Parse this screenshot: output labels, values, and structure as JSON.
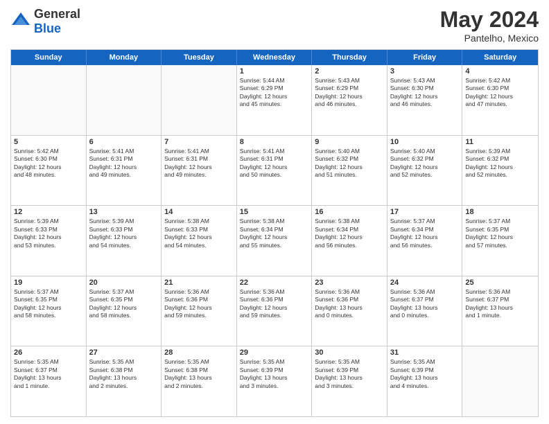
{
  "logo": {
    "general": "General",
    "blue": "Blue"
  },
  "title": "May 2024",
  "location": "Pantelho, Mexico",
  "days_of_week": [
    "Sunday",
    "Monday",
    "Tuesday",
    "Wednesday",
    "Thursday",
    "Friday",
    "Saturday"
  ],
  "weeks": [
    [
      {
        "day": "",
        "info": ""
      },
      {
        "day": "",
        "info": ""
      },
      {
        "day": "",
        "info": ""
      },
      {
        "day": "1",
        "info": "Sunrise: 5:44 AM\nSunset: 6:29 PM\nDaylight: 12 hours\nand 45 minutes."
      },
      {
        "day": "2",
        "info": "Sunrise: 5:43 AM\nSunset: 6:29 PM\nDaylight: 12 hours\nand 46 minutes."
      },
      {
        "day": "3",
        "info": "Sunrise: 5:43 AM\nSunset: 6:30 PM\nDaylight: 12 hours\nand 46 minutes."
      },
      {
        "day": "4",
        "info": "Sunrise: 5:42 AM\nSunset: 6:30 PM\nDaylight: 12 hours\nand 47 minutes."
      }
    ],
    [
      {
        "day": "5",
        "info": "Sunrise: 5:42 AM\nSunset: 6:30 PM\nDaylight: 12 hours\nand 48 minutes."
      },
      {
        "day": "6",
        "info": "Sunrise: 5:41 AM\nSunset: 6:31 PM\nDaylight: 12 hours\nand 49 minutes."
      },
      {
        "day": "7",
        "info": "Sunrise: 5:41 AM\nSunset: 6:31 PM\nDaylight: 12 hours\nand 49 minutes."
      },
      {
        "day": "8",
        "info": "Sunrise: 5:41 AM\nSunset: 6:31 PM\nDaylight: 12 hours\nand 50 minutes."
      },
      {
        "day": "9",
        "info": "Sunrise: 5:40 AM\nSunset: 6:32 PM\nDaylight: 12 hours\nand 51 minutes."
      },
      {
        "day": "10",
        "info": "Sunrise: 5:40 AM\nSunset: 6:32 PM\nDaylight: 12 hours\nand 52 minutes."
      },
      {
        "day": "11",
        "info": "Sunrise: 5:39 AM\nSunset: 6:32 PM\nDaylight: 12 hours\nand 52 minutes."
      }
    ],
    [
      {
        "day": "12",
        "info": "Sunrise: 5:39 AM\nSunset: 6:33 PM\nDaylight: 12 hours\nand 53 minutes."
      },
      {
        "day": "13",
        "info": "Sunrise: 5:39 AM\nSunset: 6:33 PM\nDaylight: 12 hours\nand 54 minutes."
      },
      {
        "day": "14",
        "info": "Sunrise: 5:38 AM\nSunset: 6:33 PM\nDaylight: 12 hours\nand 54 minutes."
      },
      {
        "day": "15",
        "info": "Sunrise: 5:38 AM\nSunset: 6:34 PM\nDaylight: 12 hours\nand 55 minutes."
      },
      {
        "day": "16",
        "info": "Sunrise: 5:38 AM\nSunset: 6:34 PM\nDaylight: 12 hours\nand 56 minutes."
      },
      {
        "day": "17",
        "info": "Sunrise: 5:37 AM\nSunset: 6:34 PM\nDaylight: 12 hours\nand 56 minutes."
      },
      {
        "day": "18",
        "info": "Sunrise: 5:37 AM\nSunset: 6:35 PM\nDaylight: 12 hours\nand 57 minutes."
      }
    ],
    [
      {
        "day": "19",
        "info": "Sunrise: 5:37 AM\nSunset: 6:35 PM\nDaylight: 12 hours\nand 58 minutes."
      },
      {
        "day": "20",
        "info": "Sunrise: 5:37 AM\nSunset: 6:35 PM\nDaylight: 12 hours\nand 58 minutes."
      },
      {
        "day": "21",
        "info": "Sunrise: 5:36 AM\nSunset: 6:36 PM\nDaylight: 12 hours\nand 59 minutes."
      },
      {
        "day": "22",
        "info": "Sunrise: 5:36 AM\nSunset: 6:36 PM\nDaylight: 12 hours\nand 59 minutes."
      },
      {
        "day": "23",
        "info": "Sunrise: 5:36 AM\nSunset: 6:36 PM\nDaylight: 13 hours\nand 0 minutes."
      },
      {
        "day": "24",
        "info": "Sunrise: 5:36 AM\nSunset: 6:37 PM\nDaylight: 13 hours\nand 0 minutes."
      },
      {
        "day": "25",
        "info": "Sunrise: 5:36 AM\nSunset: 6:37 PM\nDaylight: 13 hours\nand 1 minute."
      }
    ],
    [
      {
        "day": "26",
        "info": "Sunrise: 5:35 AM\nSunset: 6:37 PM\nDaylight: 13 hours\nand 1 minute."
      },
      {
        "day": "27",
        "info": "Sunrise: 5:35 AM\nSunset: 6:38 PM\nDaylight: 13 hours\nand 2 minutes."
      },
      {
        "day": "28",
        "info": "Sunrise: 5:35 AM\nSunset: 6:38 PM\nDaylight: 13 hours\nand 2 minutes."
      },
      {
        "day": "29",
        "info": "Sunrise: 5:35 AM\nSunset: 6:39 PM\nDaylight: 13 hours\nand 3 minutes."
      },
      {
        "day": "30",
        "info": "Sunrise: 5:35 AM\nSunset: 6:39 PM\nDaylight: 13 hours\nand 3 minutes."
      },
      {
        "day": "31",
        "info": "Sunrise: 5:35 AM\nSunset: 6:39 PM\nDaylight: 13 hours\nand 4 minutes."
      },
      {
        "day": "",
        "info": ""
      }
    ]
  ]
}
